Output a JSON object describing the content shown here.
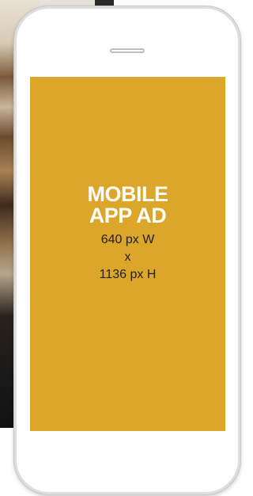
{
  "ad": {
    "title_line1": "MOBILE",
    "title_line2": "APP AD",
    "width_text": "640 px W",
    "separator": "x",
    "height_text": "1136 px H",
    "screen_color": "#dba629",
    "text_color": "#ffffff"
  },
  "device": {
    "type": "smartphone",
    "icon": "phone-speaker-icon"
  }
}
